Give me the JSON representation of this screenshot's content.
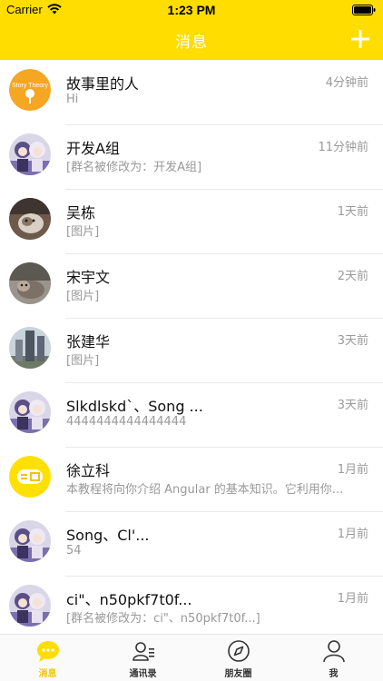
{
  "status_bar": {
    "carrier": "Carrier",
    "time": "1:23 PM"
  },
  "nav": {
    "title": "消息",
    "add_icon": "plus-icon"
  },
  "conversations": [
    {
      "name": "故事里的人",
      "preview": "Hi",
      "time": "4分钟前",
      "avatar": "story-theory-logo"
    },
    {
      "name": "开发A组",
      "preview": "[群名被修改为：开发A组]",
      "time": "11分钟前",
      "avatar": "anime-group-avatar"
    },
    {
      "name": "吴栋",
      "preview": "[图片]",
      "time": "1天前",
      "avatar": "cat-photo"
    },
    {
      "name": "宋宇文",
      "preview": "[图片]",
      "time": "2天前",
      "avatar": "cat-photo"
    },
    {
      "name": "张建华",
      "preview": "[图片]",
      "time": "3天前",
      "avatar": "building-photo"
    },
    {
      "name": "Slkdlskd`、Song ...",
      "preview": "4444444444444444",
      "time": "3天前",
      "avatar": "anime-group-avatar"
    },
    {
      "name": "徐立科",
      "preview": "本教程将向你介绍 Angular 的基本知识。它利用你...",
      "time": "1月前",
      "avatar": "huati-logo"
    },
    {
      "name": "Song、Cl'...",
      "preview": "54",
      "time": "1月前",
      "avatar": "anime-group-avatar"
    },
    {
      "name": "ci\"、n50pkf7t0f...",
      "preview": "[群名被修改为：ci\"、n50pkf7t0f...]",
      "time": "1月前",
      "avatar": "anime-group-avatar"
    }
  ],
  "tabs": [
    {
      "label": "消息",
      "icon": "chat-bubble-icon",
      "active": true
    },
    {
      "label": "通讯录",
      "icon": "contacts-icon",
      "active": false
    },
    {
      "label": "朋友圈",
      "icon": "compass-icon",
      "active": false
    },
    {
      "label": "我",
      "icon": "person-icon",
      "active": false
    }
  ],
  "colors": {
    "accent": "#FFDD00",
    "tab_active": "#F2C300",
    "title": "#ffffff"
  }
}
